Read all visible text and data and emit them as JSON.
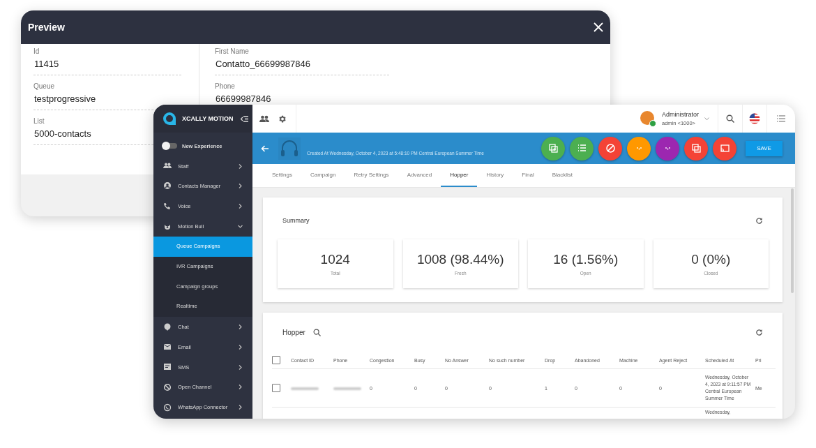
{
  "preview": {
    "title": "Preview",
    "fields_left": [
      {
        "label": "Id",
        "value": "11415"
      },
      {
        "label": "Queue",
        "value": "testprogressive"
      },
      {
        "label": "List",
        "value": "5000-contacts"
      }
    ],
    "fields_right": [
      {
        "label": "First Name",
        "value": "Contatto_66699987846"
      },
      {
        "label": "Phone",
        "value": "66699987846"
      }
    ]
  },
  "app": {
    "brand": "XCALLY MOTION",
    "new_experience": {
      "label": "New Experience",
      "on": false
    },
    "sidebar": {
      "items": [
        {
          "label": "Staff",
          "kind": "people",
          "expanded": false
        },
        {
          "label": "Contacts Manager",
          "kind": "contact",
          "expanded": false
        },
        {
          "label": "Voice",
          "kind": "phone",
          "expanded": false
        },
        {
          "label": "Motion Bull",
          "kind": "bull",
          "expanded": true,
          "children": [
            {
              "label": "Queue Campaigns",
              "selected": true
            },
            {
              "label": "IVR Campaigns",
              "selected": false
            },
            {
              "label": "Campaign groups",
              "selected": false
            },
            {
              "label": "Realtime",
              "selected": false
            }
          ]
        },
        {
          "label": "Chat",
          "kind": "chat",
          "expanded": false
        },
        {
          "label": "Email",
          "kind": "email",
          "expanded": false
        },
        {
          "label": "SMS",
          "kind": "sms",
          "expanded": false
        },
        {
          "label": "Open Channel",
          "kind": "channel",
          "expanded": false
        },
        {
          "label": "WhatsApp Connector",
          "kind": "whatsapp",
          "expanded": false
        }
      ]
    },
    "user": {
      "name": "Administrator",
      "account": "admin <1000>"
    },
    "toolbar": {
      "created": "Created At Wednesday, October 4, 2023 at 5:48:10 PM Central European Summer Time",
      "actions": [
        {
          "kind": "copy-plus",
          "color": "#4caf50"
        },
        {
          "kind": "list",
          "color": "#4caf50"
        },
        {
          "kind": "block",
          "color": "#f44336"
        },
        {
          "kind": "dots",
          "color": "#ff9800"
        },
        {
          "kind": "dots",
          "color": "#9c27b0"
        },
        {
          "kind": "copy",
          "color": "#f44336"
        },
        {
          "kind": "cast",
          "color": "#f44336"
        }
      ],
      "save": "SAVE"
    },
    "tabs": [
      {
        "label": "Settings",
        "selected": false
      },
      {
        "label": "Campaign",
        "selected": false
      },
      {
        "label": "Retry Settings",
        "selected": false
      },
      {
        "label": "Advanced",
        "selected": false
      },
      {
        "label": "Hopper",
        "selected": true
      },
      {
        "label": "History",
        "selected": false
      },
      {
        "label": "Final",
        "selected": false
      },
      {
        "label": "Blacklist",
        "selected": false
      }
    ],
    "summary": {
      "title": "Summary",
      "stats": [
        {
          "value": "1024",
          "label": "Total"
        },
        {
          "value": "1008 (98.44%)",
          "label": "Fresh"
        },
        {
          "value": "16 (1.56%)",
          "label": "Open"
        },
        {
          "value": "0 (0%)",
          "label": "Closed"
        }
      ]
    },
    "hopper": {
      "title": "Hopper",
      "select_all_checked": false,
      "columns": [
        "Contact ID",
        "Phone",
        "Congestion",
        "Busy",
        "No Answer",
        "No such number",
        "Drop",
        "Abandoned",
        "Machine",
        "Agent Reject",
        "Scheduled At",
        "Pri"
      ],
      "rows": [
        {
          "checked": false,
          "cells": [
            "",
            "",
            "0",
            "0",
            "0",
            "0",
            "1",
            "0",
            "0",
            "0",
            "Wednesday, October 4, 2023 at 9:11:57 PM Central European Summer Time",
            "Me"
          ]
        },
        {
          "cells": [
            "",
            "",
            "",
            "",
            "",
            "",
            "",
            "",
            "",
            "",
            "Wednesday,",
            ""
          ]
        }
      ]
    }
  }
}
